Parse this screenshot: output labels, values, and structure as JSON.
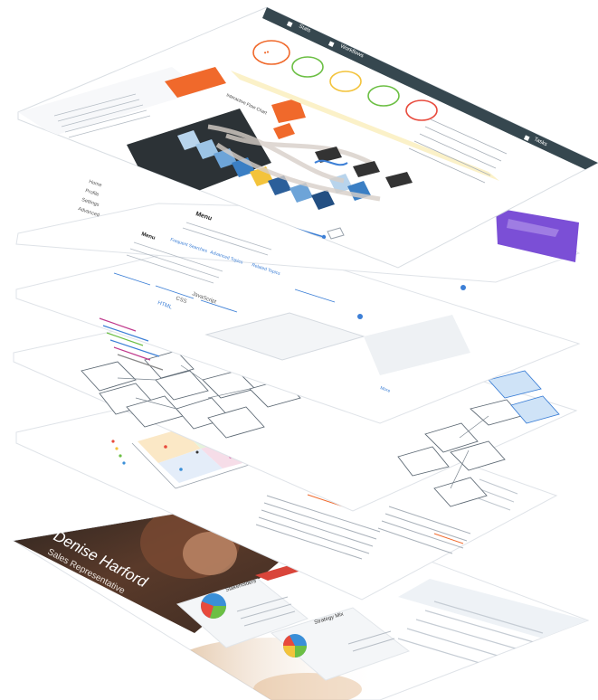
{
  "layers": {
    "dashboard": {
      "nav_left": "Stats",
      "nav_mid": "Workflows",
      "nav_right": "Tasks",
      "panel_title": "Interactive Flow Chart"
    },
    "docs": {
      "heading": "Menu",
      "section": "Menu",
      "nav": [
        "Home",
        "Profile",
        "Settings",
        "Advanced"
      ],
      "links": [
        "Frequent Searches",
        "Advanced Topics",
        "Related Topics"
      ],
      "tabs": [
        "HTML",
        "CSS",
        "JavaScript"
      ]
    },
    "profile": {
      "name": "Denise Harford",
      "role": "Sales Representative",
      "card_1": "Stakeholders",
      "card_2": "Strategy Mix"
    }
  },
  "colors": {
    "nav_bar": "#36474f",
    "accent_orange": "#f0692b",
    "accent_purple": "#7b4fd6",
    "accent_blue": "#3c7fd6",
    "pie_blue": "#3a8fd8",
    "pie_green": "#6cbf44",
    "pie_red": "#e84a3c",
    "pie_yellow": "#f3c33b"
  }
}
